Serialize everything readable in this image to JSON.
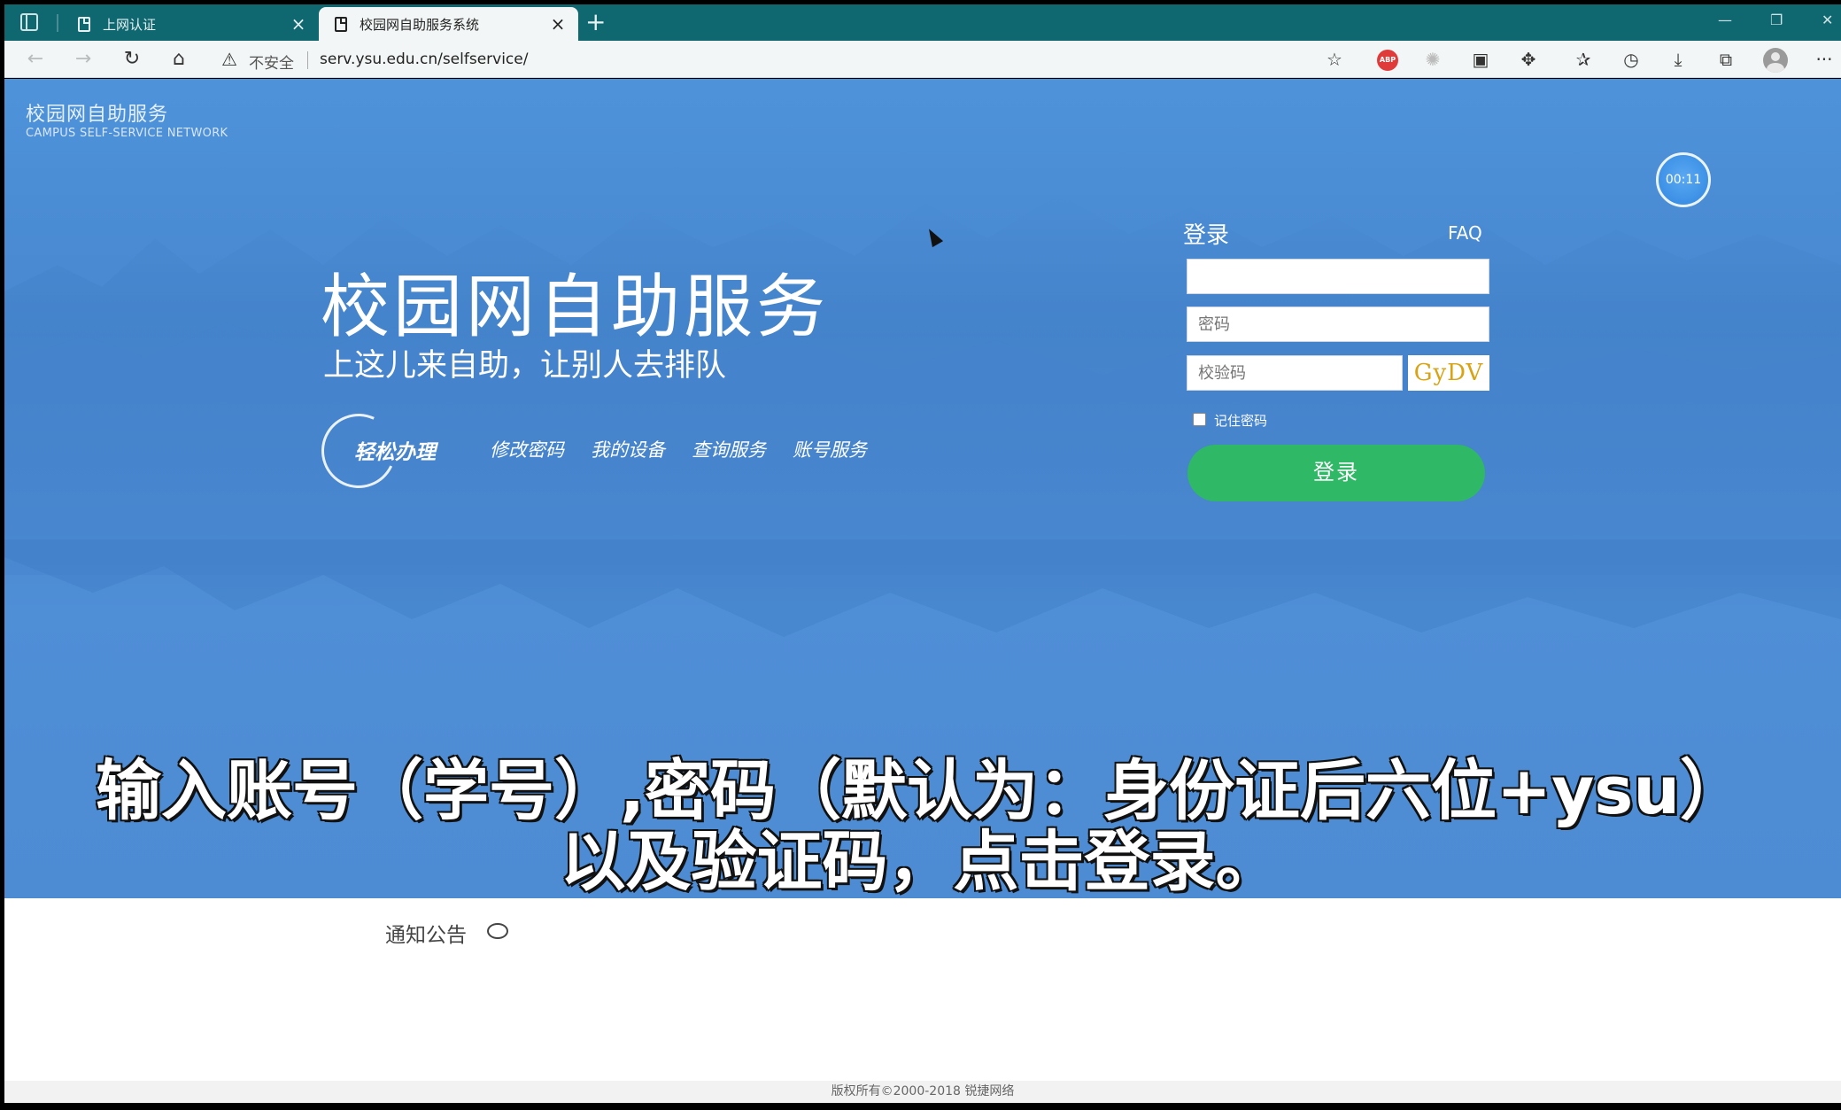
{
  "browser": {
    "tabs": [
      {
        "title": "上网认证",
        "close": "×"
      },
      {
        "title": "校园网自助服务系统",
        "close": "×"
      }
    ],
    "new_tab": "+",
    "window_controls": {
      "minimize": "—",
      "restore": "❐",
      "close": "✕"
    },
    "address": {
      "security_label": "不安全",
      "url": "serv.ysu.edu.cn/selfservice/"
    },
    "icons": {
      "back": "back-arrow-icon",
      "forward": "forward-arrow-icon",
      "reload": "reload-icon",
      "home": "home-icon",
      "extensions": [
        "adblock-plus-icon",
        "extension-icon",
        "extension-icon",
        "puzzle-icon"
      ],
      "favorites": "favorites-icon",
      "history": "history-icon",
      "downloads": "download-icon",
      "collections": "collections-icon",
      "profile": "profile-avatar-icon",
      "menu": "more-menu-icon"
    },
    "adblock_text": "ABP",
    "menu_glyph": "···"
  },
  "site": {
    "logo_cn": "校园网自助服务",
    "logo_en": "CAMPUS  SELF-SERVICE NETWORK",
    "timer": "00:11",
    "hero_title": "校园网自助服务",
    "hero_subtitle": "上这儿来自助，让别人去排队",
    "easy_label": "轻松办理",
    "quick_links": [
      "修改密码",
      "我的设备",
      "查询服务",
      "账号服务"
    ]
  },
  "login": {
    "title": "登录",
    "faq": "FAQ",
    "username_value": "",
    "password_placeholder": "密码",
    "captcha_placeholder": "校验码",
    "captcha_text": "GyDV",
    "remember_label": "记住密码",
    "remember_checked": false,
    "submit_label": "登录",
    "submit_color": "#2fb865"
  },
  "caption": {
    "line1": "输入账号（学号）,密码（默认为：身份证后六位+ysu）",
    "line2": "以及验证码，点击登录。"
  },
  "notice": {
    "label": "通知公告",
    "icon": "speech-bubble-icon"
  },
  "footer": {
    "copyright": "版权所有©2000-2018 锐捷网络"
  },
  "colors": {
    "tabbar": "#0f6770",
    "hero_blue": "#4a8bd3",
    "captcha_text": "#d8a314"
  }
}
